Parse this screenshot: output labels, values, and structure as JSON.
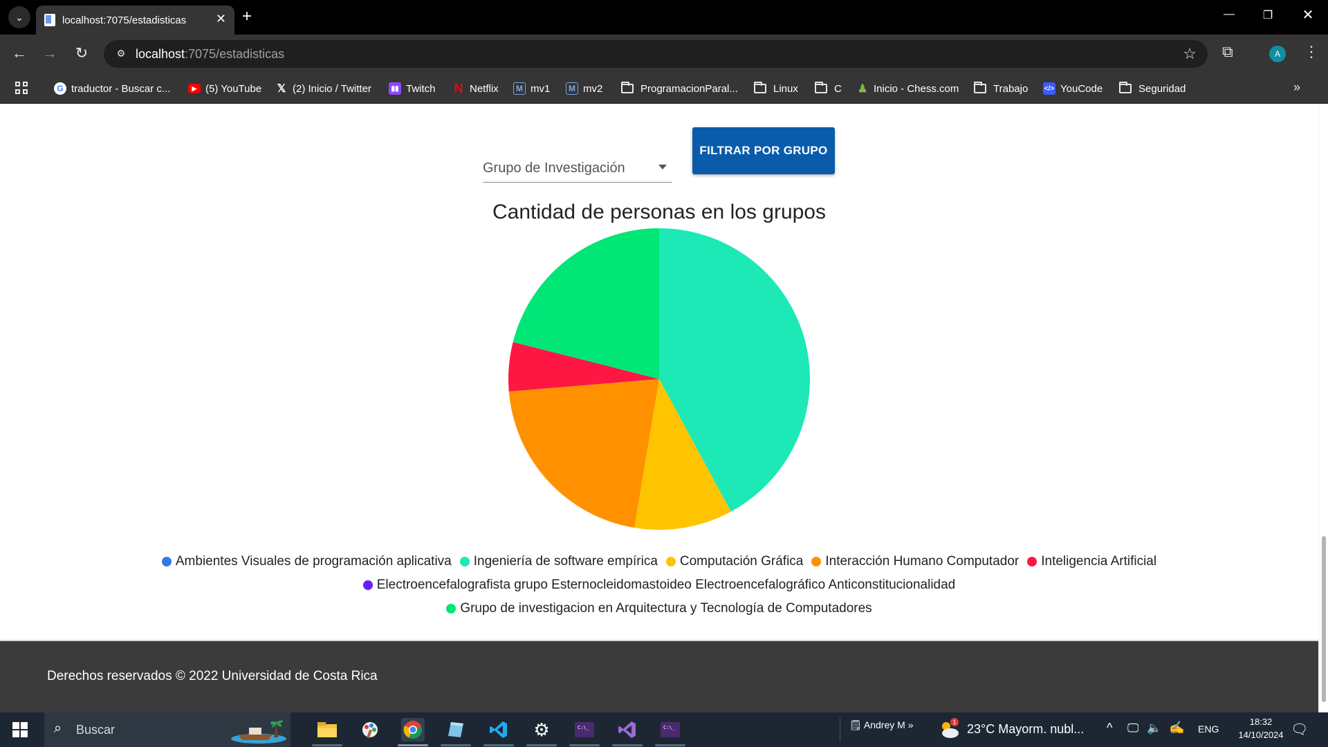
{
  "browser": {
    "tab_title": "localhost:7075/estadisticas",
    "url_host": "localhost",
    "url_path": ":7075/estadisticas",
    "avatar_letter": "A",
    "bookmarks": [
      {
        "label": "traductor - Buscar c...",
        "icon": "google-icon",
        "kind": "site"
      },
      {
        "label": "(5) YouTube",
        "icon": "youtube-icon",
        "kind": "site"
      },
      {
        "label": "(2) Inicio / Twitter",
        "icon": "x-icon",
        "kind": "site"
      },
      {
        "label": "Twitch",
        "icon": "twitch-icon",
        "kind": "site"
      },
      {
        "label": "Netflix",
        "icon": "netflix-icon",
        "kind": "site"
      },
      {
        "label": "mv1",
        "icon": "m-icon",
        "kind": "site"
      },
      {
        "label": "mv2",
        "icon": "m-icon",
        "kind": "site"
      },
      {
        "label": "ProgramacionParal...",
        "icon": "folder-icon",
        "kind": "folder"
      },
      {
        "label": "Linux",
        "icon": "folder-icon",
        "kind": "folder"
      },
      {
        "label": "C",
        "icon": "folder-icon",
        "kind": "folder"
      },
      {
        "label": "Inicio - Chess.com",
        "icon": "chess-icon",
        "kind": "site"
      },
      {
        "label": "Trabajo",
        "icon": "folder-icon",
        "kind": "folder"
      },
      {
        "label": "YouCode",
        "icon": "youcode-icon",
        "kind": "site"
      },
      {
        "label": "Seguridad",
        "icon": "folder-icon",
        "kind": "folder"
      }
    ]
  },
  "filter": {
    "select_label": "Grupo de Investigación",
    "button_label": "FILTRAR POR GRUPO"
  },
  "chart_data": {
    "type": "pie",
    "title": "Cantidad de personas en los grupos",
    "series": [
      {
        "name": "Ambientes Visuales de programación aplicativa",
        "value": 0,
        "color": "#2f7be6"
      },
      {
        "name": "Ingeniería de software empírica",
        "value": 8,
        "color": "#1de9b6"
      },
      {
        "name": "Computación Gráfica",
        "value": 2,
        "color": "#ffc400"
      },
      {
        "name": "Interacción Humano Computador",
        "value": 4,
        "color": "#ff9100"
      },
      {
        "name": "Inteligencia Artificial",
        "value": 1,
        "color": "#ff1744"
      },
      {
        "name": "Electroencefalografista grupo Esternocleidomastoideo Electroencefalográfico Anticonstitucionalidad",
        "value": 0,
        "color": "#651fff"
      },
      {
        "name": "Grupo de investigacion en Arquitectura y Tecnología de Computadores",
        "value": 4,
        "color": "#00e676"
      }
    ],
    "legend_position": "bottom"
  },
  "footer": {
    "text": "Derechos reservados © 2022 Universidad de Costa Rica"
  },
  "taskbar": {
    "search_placeholder": "Buscar",
    "user_label": "Andrey M",
    "weather": "23°C  Mayorm. nubl...",
    "weather_badge": "1",
    "language": "ENG",
    "time": "18:32",
    "date": "14/10/2024"
  }
}
